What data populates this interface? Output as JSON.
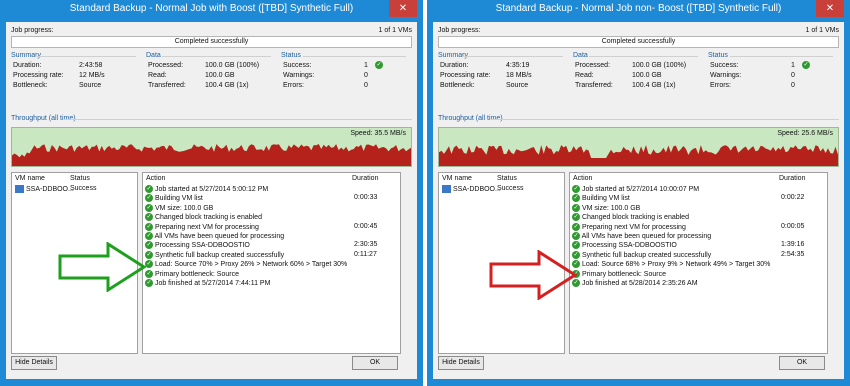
{
  "windows": [
    {
      "title": "Standard Backup - Normal Job with Boost ([TBD] Synthetic Full)",
      "job_progress_label": "Job progress:",
      "vm_count": "1 of 1 VMs",
      "progress_text": "Completed successfully",
      "summary": {
        "title": "Summary",
        "duration_label": "Duration:",
        "duration": "2:43:58",
        "rate_label": "Processing rate:",
        "rate": "12 MB/s",
        "bottleneck_label": "Bottleneck:",
        "bottleneck": "Source"
      },
      "data": {
        "title": "Data",
        "processed_label": "Processed:",
        "processed": "100.0 GB (100%)",
        "read_label": "Read:",
        "read": "100.0 GB",
        "transferred_label": "Transferred:",
        "transferred": "100.4 GB (1x)"
      },
      "status": {
        "title": "Status",
        "success_label": "Success:",
        "success": "1",
        "warnings_label": "Warnings:",
        "warnings": "0",
        "errors_label": "Errors:",
        "errors": "0"
      },
      "throughput_title": "Throughput (all time)",
      "speed": "Speed: 35.5 MB/s",
      "vm_table": {
        "col_name": "VM name",
        "col_status": "Status",
        "rows": [
          {
            "name": "SSA-DDBOO...",
            "status": "Success"
          }
        ]
      },
      "action_table": {
        "col_action": "Action",
        "col_duration": "Duration",
        "rows": [
          {
            "text": "Job started at 5/27/2014 5:00:12 PM",
            "duration": ""
          },
          {
            "text": "Building VM list",
            "duration": "0:00:33"
          },
          {
            "text": "VM size: 100.0 GB",
            "duration": ""
          },
          {
            "text": "Changed block tracking is enabled",
            "duration": ""
          },
          {
            "text": "Preparing next VM for processing",
            "duration": "0:00:45"
          },
          {
            "text": "All VMs have been queued for processing",
            "duration": ""
          },
          {
            "text": "Processing SSA-DDBOOSTIO",
            "duration": "2:30:35"
          },
          {
            "text": "Synthetic full backup created successfully",
            "duration": "0:11:27"
          },
          {
            "text": "Load: Source 70% > Proxy 26% > Network 60% > Target 30%",
            "duration": ""
          },
          {
            "text": "Primary bottleneck: Source",
            "duration": ""
          },
          {
            "text": "Job finished at 5/27/2014 7:44:11 PM",
            "duration": ""
          }
        ]
      },
      "hide_details": "Hide Details",
      "ok": "OK",
      "arrow_color": "#1ea01e"
    },
    {
      "title": "Standard Backup - Normal Job non- Boost ([TBD] Synthetic Full)",
      "job_progress_label": "Job progress:",
      "vm_count": "1 of 1 VMs",
      "progress_text": "Completed successfully",
      "summary": {
        "title": "Summary",
        "duration_label": "Duration:",
        "duration": "4:35:19",
        "rate_label": "Processing rate:",
        "rate": "18 MB/s",
        "bottleneck_label": "Bottleneck:",
        "bottleneck": "Source"
      },
      "data": {
        "title": "Data",
        "processed_label": "Processed:",
        "processed": "100.0 GB (100%)",
        "read_label": "Read:",
        "read": "100.0 GB",
        "transferred_label": "Transferred:",
        "transferred": "100.4 GB (1x)"
      },
      "status": {
        "title": "Status",
        "success_label": "Success:",
        "success": "1",
        "warnings_label": "Warnings:",
        "warnings": "0",
        "errors_label": "Errors:",
        "errors": "0"
      },
      "throughput_title": "Throughput (all time)",
      "speed": "Speed: 25.6 MB/s",
      "vm_table": {
        "col_name": "VM name",
        "col_status": "Status",
        "rows": [
          {
            "name": "SSA-DDBOO...",
            "status": "Success"
          }
        ]
      },
      "action_table": {
        "col_action": "Action",
        "col_duration": "Duration",
        "rows": [
          {
            "text": "Job started at 5/27/2014 10:00:07 PM",
            "duration": ""
          },
          {
            "text": "Building VM list",
            "duration": "0:00:22"
          },
          {
            "text": "VM size: 100.0 GB",
            "duration": ""
          },
          {
            "text": "Changed block tracking is enabled",
            "duration": ""
          },
          {
            "text": "Preparing next VM for processing",
            "duration": "0:00:05"
          },
          {
            "text": "All VMs have been queued for processing",
            "duration": ""
          },
          {
            "text": "Processing SSA-DDBOOSTIO",
            "duration": "1:39:16"
          },
          {
            "text": "Synthetic full backup created successfully",
            "duration": "2:54:35"
          },
          {
            "text": "Load: Source 68% > Proxy 9% > Network 49% > Target 30%",
            "duration": ""
          },
          {
            "text": "Primary bottleneck: Source",
            "duration": ""
          },
          {
            "text": "Job finished at 5/28/2014 2:35:26 AM",
            "duration": ""
          }
        ]
      },
      "hide_details": "Hide Details",
      "ok": "OK",
      "arrow_color": "#d42020"
    }
  ],
  "colors": {
    "titlebar": "#1e8ad6",
    "close": "#c9403a",
    "chart_fill": "#b5221c",
    "chart_bg": "#c9e8c2"
  }
}
